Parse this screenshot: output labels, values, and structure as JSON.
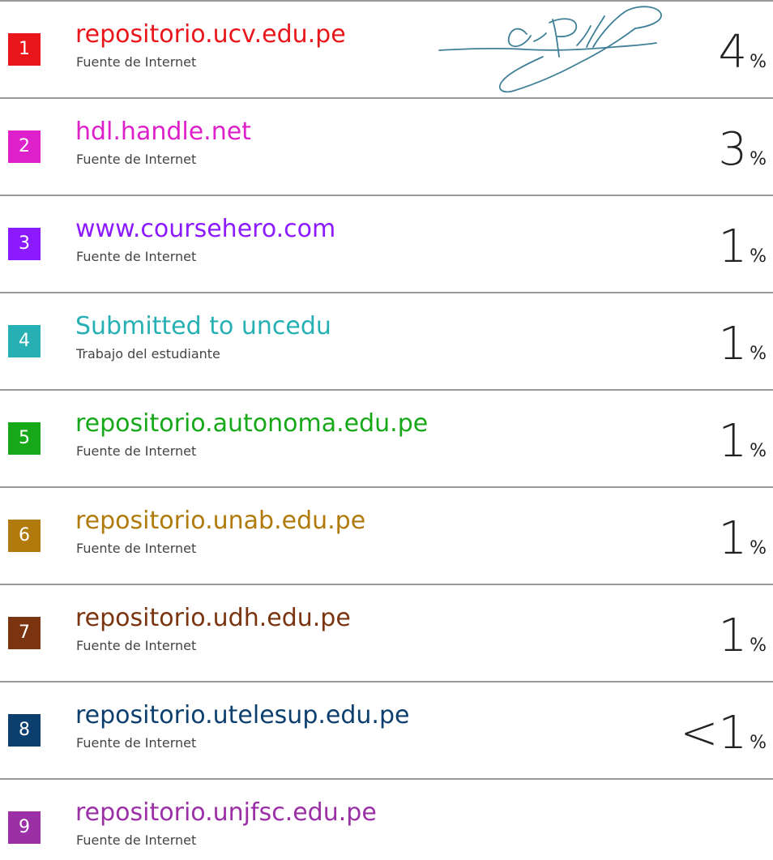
{
  "sources": [
    {
      "rank": "1",
      "name": "repositorio.ucv.edu.pe",
      "type": "Fuente de Internet",
      "percent": "4",
      "percent_symbol": "%",
      "color": "#e8161b"
    },
    {
      "rank": "2",
      "name": "hdl.handle.net",
      "type": "Fuente de Internet",
      "percent": "3",
      "percent_symbol": "%",
      "color": "#dd20c9"
    },
    {
      "rank": "3",
      "name": "www.coursehero.com",
      "type": "Fuente de Internet",
      "percent": "1",
      "percent_symbol": "%",
      "color": "#8c1aff"
    },
    {
      "rank": "4",
      "name": "Submitted to uncedu",
      "type": "Trabajo del estudiante",
      "percent": "1",
      "percent_symbol": "%",
      "color": "#26b0b3"
    },
    {
      "rank": "5",
      "name": "repositorio.autonoma.edu.pe",
      "type": "Fuente de Internet",
      "percent": "1",
      "percent_symbol": "%",
      "color": "#17a81a"
    },
    {
      "rank": "6",
      "name": "repositorio.unab.edu.pe",
      "type": "Fuente de Internet",
      "percent": "1",
      "percent_symbol": "%",
      "color": "#b07a0c"
    },
    {
      "rank": "7",
      "name": "repositorio.udh.edu.pe",
      "type": "Fuente de Internet",
      "percent": "1",
      "percent_symbol": "%",
      "color": "#7a3510"
    },
    {
      "rank": "8",
      "name": "repositorio.utelesup.edu.pe",
      "type": "Fuente de Internet",
      "percent": "<1",
      "percent_symbol": "%",
      "color": "#0d3f6e"
    },
    {
      "rank": "9",
      "name": "repositorio.unjfsc.edu.pe",
      "type": "Fuente de Internet",
      "percent": "",
      "percent_symbol": "",
      "color": "#9b2fa6"
    }
  ],
  "signature": {
    "ink_color": "#3f7f98"
  }
}
